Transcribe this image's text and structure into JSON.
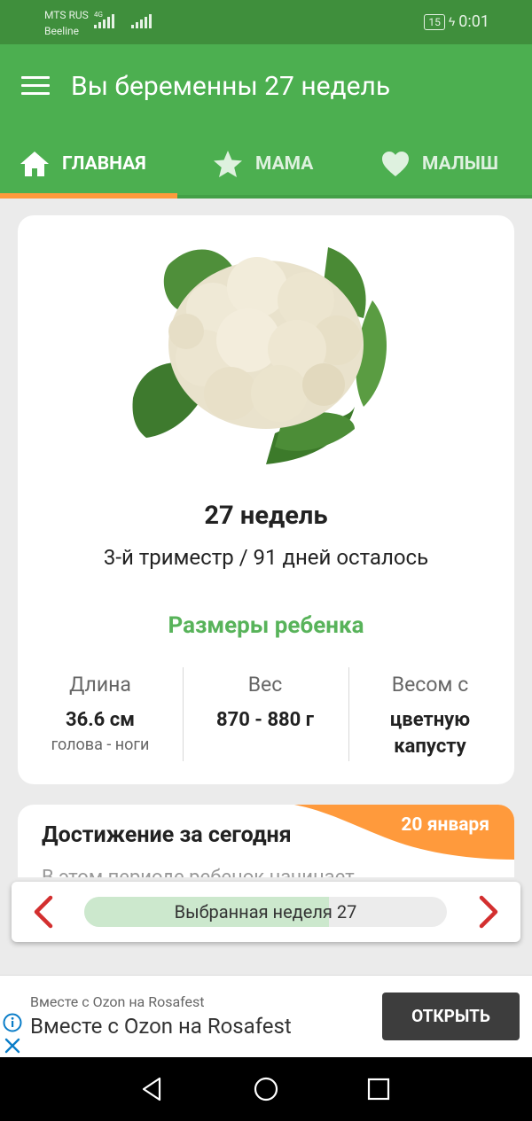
{
  "status_bar": {
    "carrier_1": "MTS RUS",
    "carrier_2": "Beeline",
    "network": "4G",
    "battery": "15",
    "time": "0:01"
  },
  "app_bar": {
    "title": "Вы беременны 27 недель",
    "menu_icon": "hamburger-menu-icon"
  },
  "tabs": [
    {
      "label": "ГЛАВНАЯ",
      "icon": "home-icon",
      "active": true
    },
    {
      "label": "МАМА",
      "icon": "star-icon",
      "active": false
    },
    {
      "label": "МАЛЫШ",
      "icon": "heart-icon",
      "active": false
    }
  ],
  "main_card": {
    "image": "cauliflower",
    "weeks_title": "27 недель",
    "trimester_info": "3-й триместр / 91 дней осталось",
    "sizes_heading": "Размеры ребенка",
    "stats": [
      {
        "label": "Длина",
        "value": "36.6 см",
        "sub": "голова - ноги"
      },
      {
        "label": "Вес",
        "value": "870 - 880 г",
        "sub": ""
      },
      {
        "label": "Весом с",
        "value": "цветную капусту",
        "sub": ""
      }
    ]
  },
  "achievement": {
    "title": "Достижение за сегодня",
    "date": "20 января",
    "preview_text": "В этом периоде ребенок начинает"
  },
  "week_selector": {
    "label": "Выбранная неделя 27",
    "progress_fraction": 0.675
  },
  "ad": {
    "subtitle": "Вместе с Ozon на Rosafest",
    "title": "Вместе с Ozon на Rosafest",
    "button": "ОТКРЫТЬ"
  },
  "colors": {
    "status_bar": "#3f8f3c",
    "primary": "#4caf50",
    "accent": "#ff9a3c",
    "heading_green": "#58b35a",
    "arrow_red": "#d32f2f"
  }
}
